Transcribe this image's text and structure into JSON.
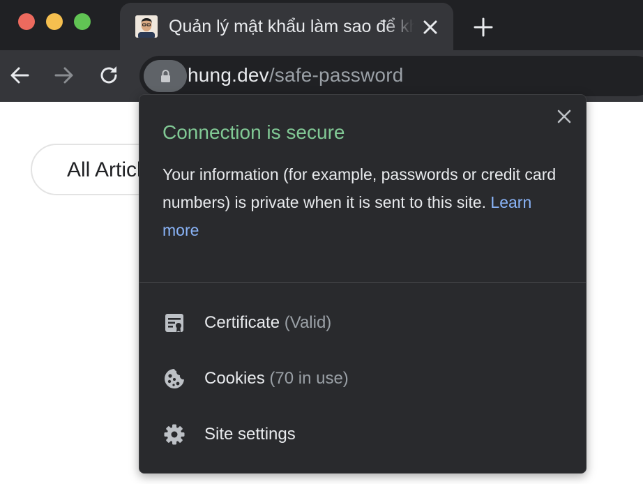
{
  "window": {
    "traffic_lights": [
      "#ed6a5e",
      "#f5bf4f",
      "#61c454"
    ]
  },
  "tab": {
    "title": "Quản lý mật khẩu làm sao để khỏi quên",
    "favicon": "avatar-favicon"
  },
  "toolbar": {
    "back_icon": "arrow-left-icon",
    "forward_icon": "arrow-right-icon",
    "reload_icon": "reload-icon"
  },
  "omnibox": {
    "host": "hung.dev",
    "path": "/safe-password",
    "lock_icon": "lock-icon"
  },
  "page": {
    "pill_label": "All Articles"
  },
  "popup": {
    "title": "Connection is secure",
    "body": "Your information (for example, passwords or credit card numbers) is private when it is sent to this site.",
    "learn_more": "Learn more",
    "items": [
      {
        "label": "Certificate",
        "sub": "(Valid)",
        "icon": "certificate-icon"
      },
      {
        "label": "Cookies",
        "sub": "(70 in use)",
        "icon": "cookie-icon"
      },
      {
        "label": "Site settings",
        "sub": "",
        "icon": "gear-icon"
      }
    ],
    "colors": {
      "title": "#81c995",
      "link": "#8ab4f8",
      "background": "#292a2d"
    }
  }
}
